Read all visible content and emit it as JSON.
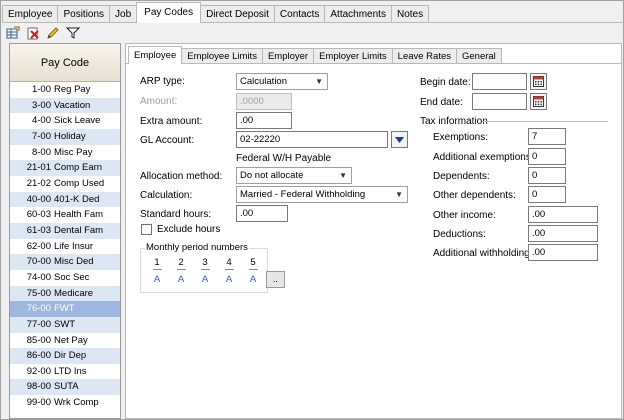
{
  "top_tabs": [
    {
      "label": "Employee"
    },
    {
      "label": "Positions"
    },
    {
      "label": "Job"
    },
    {
      "label": "Pay Codes"
    },
    {
      "label": "Direct Deposit"
    },
    {
      "label": "Contacts"
    },
    {
      "label": "Attachments"
    },
    {
      "label": "Notes"
    }
  ],
  "toolbar": {
    "icons": [
      "grid-edit-icon",
      "delete-icon",
      "pencil-icon",
      "filter-icon"
    ]
  },
  "left_pane": {
    "header": "Pay Code",
    "items": [
      {
        "code": "1-00",
        "name": "Reg Pay"
      },
      {
        "code": "3-00",
        "name": "Vacation"
      },
      {
        "code": "4-00",
        "name": "Sick Leave"
      },
      {
        "code": "7-00",
        "name": "Holiday"
      },
      {
        "code": "8-00",
        "name": "Misc Pay"
      },
      {
        "code": "21-01",
        "name": "Comp Earn"
      },
      {
        "code": "21-02",
        "name": "Comp Used"
      },
      {
        "code": "40-00",
        "name": "401-K Ded"
      },
      {
        "code": "60-03",
        "name": "Health Fam"
      },
      {
        "code": "61-03",
        "name": "Dental Fam"
      },
      {
        "code": "62-00",
        "name": "Life Insur"
      },
      {
        "code": "70-00",
        "name": "Misc Ded"
      },
      {
        "code": "74-00",
        "name": "Soc Sec"
      },
      {
        "code": "75-00",
        "name": "Medicare"
      },
      {
        "code": "76-00",
        "name": "FWT"
      },
      {
        "code": "77-00",
        "name": "SWT"
      },
      {
        "code": "85-00",
        "name": "Net Pay"
      },
      {
        "code": "86-00",
        "name": "Dir Dep"
      },
      {
        "code": "92-00",
        "name": "LTD Ins"
      },
      {
        "code": "98-00",
        "name": "SUTA"
      },
      {
        "code": "99-00",
        "name": "Wrk Comp"
      }
    ],
    "selected_code": "76-00"
  },
  "sub_tabs": [
    {
      "label": "Employee"
    },
    {
      "label": "Employee Limits"
    },
    {
      "label": "Employer"
    },
    {
      "label": "Employer Limits"
    },
    {
      "label": "Leave Rates"
    },
    {
      "label": "General"
    }
  ],
  "form": {
    "arp_type_label": "ARP type:",
    "arp_type_value": "Calculation",
    "amount_label": "Amount:",
    "amount_value": ".0000",
    "extra_amount_label": "Extra amount:",
    "extra_amount_value": ".00",
    "gl_account_label": "GL Account:",
    "gl_account_value": "02-22220",
    "gl_account_desc": "Federal W/H Payable",
    "allocation_label": "Allocation method:",
    "allocation_value": "Do not allocate",
    "calculation_label": "Calculation:",
    "calculation_value": "Married - Federal Withholding",
    "standard_hours_label": "Standard hours:",
    "standard_hours_value": ".00",
    "exclude_hours_label": "Exclude hours",
    "monthly_period_title": "Monthly period numbers",
    "periods": [
      {
        "num": "1",
        "val": "A"
      },
      {
        "num": "2",
        "val": "A"
      },
      {
        "num": "3",
        "val": "A"
      },
      {
        "num": "4",
        "val": "A"
      },
      {
        "num": "5",
        "val": "A"
      }
    ],
    "more_button": "..",
    "begin_date_label": "Begin date:",
    "begin_date_value": "",
    "end_date_label": "End date:",
    "end_date_value": "",
    "tax_info_title": "Tax information",
    "exemptions_label": "Exemptions:",
    "exemptions_value": "7",
    "add_exemptions_label": "Additional exemptions:",
    "add_exemptions_value": "0",
    "dependents_label": "Dependents:",
    "dependents_value": "0",
    "other_dependents_label": "Other dependents:",
    "other_dependents_value": "0",
    "other_income_label": "Other income:",
    "other_income_value": ".00",
    "deductions_label": "Deductions:",
    "deductions_value": ".00",
    "add_withholding_label": "Additional withholding:",
    "add_withholding_value": ".00"
  }
}
